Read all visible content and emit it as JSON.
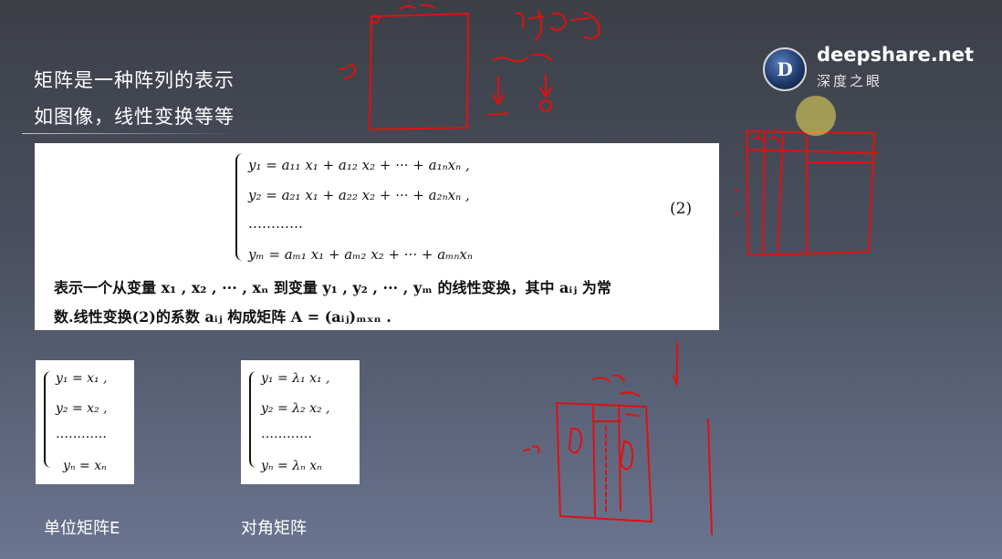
{
  "slide": {
    "heading_line1": "矩阵是一种阵列的表示",
    "heading_line2": "如图像，线性变换等等"
  },
  "brand": {
    "logo_letter": "D",
    "name": "deepshare.net",
    "subtitle": "深度之眼"
  },
  "equation_box": {
    "lines": [
      "y₁ = a₁₁ x₁ + a₁₂ x₂ + ··· + a₁ₙxₙ ,",
      "y₂ = a₂₁ x₁ + a₂₂ x₂ + ··· + a₂ₙxₙ ,",
      "…………",
      "yₘ = aₘ₁ x₁ + aₘ₂ x₂ + ··· + aₘₙxₙ"
    ],
    "number": "(2)",
    "desc_line1": "表示一个从变量 x₁ , x₂ , ··· , xₙ 到变量 y₁ , y₂ , ··· , yₘ 的线性变换，其中 aᵢⱼ 为常",
    "desc_line2": "数.线性变换(2)的系数 aᵢⱼ 构成矩阵 A = (aᵢⱼ)ₘₓₙ ."
  },
  "identity_box": {
    "lines": [
      "y₁ = x₁ ,",
      "y₂ = x₂ ,",
      "…………",
      "yₙ = xₙ"
    ]
  },
  "diagonal_box": {
    "lines": [
      "y₁ = λ₁ x₁ ,",
      "y₂ = λ₂ x₂ ,",
      "…………",
      "yₙ = λₙ xₙ"
    ]
  },
  "captions": {
    "identity": "单位矩阵E",
    "diagonal": "对角矩阵"
  },
  "colors": {
    "ink": "#e01010",
    "cursor_highlight": "#f2e05a",
    "text_white": "#ffffff"
  }
}
